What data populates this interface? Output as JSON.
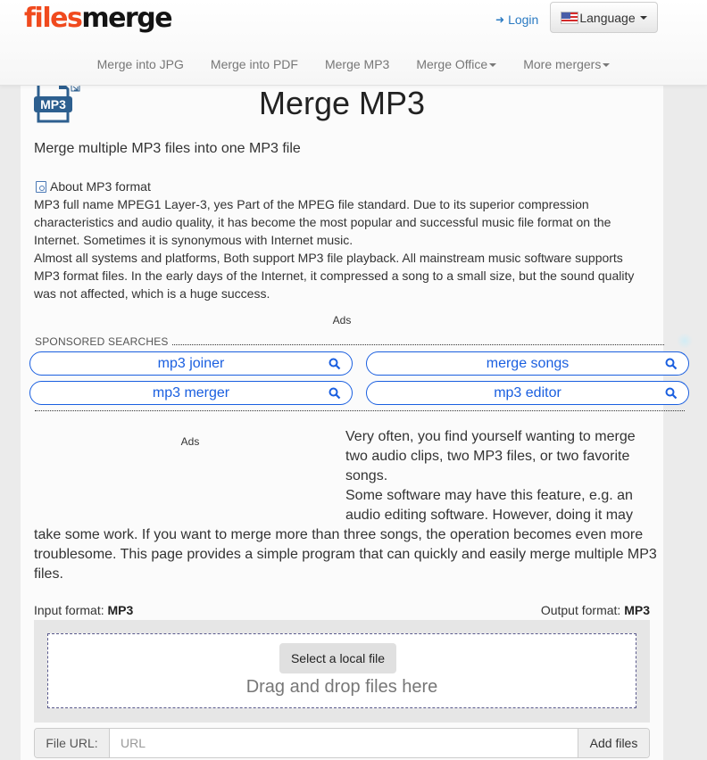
{
  "header": {
    "logo_part1": "files",
    "logo_part2": "merge",
    "login_label": "Login",
    "language_label": "Language",
    "nav": [
      {
        "label": "Merge into JPG",
        "dropdown": false
      },
      {
        "label": "Merge into PDF",
        "dropdown": false
      },
      {
        "label": "Merge MP3",
        "dropdown": false
      },
      {
        "label": "Merge Office",
        "dropdown": true
      },
      {
        "label": "More mergers",
        "dropdown": true
      }
    ]
  },
  "main": {
    "icon_label": "MP3",
    "title": "Merge MP3",
    "subtitle": "Merge multiple MP3 files into one MP3 file",
    "about_heading": "About MP3 format",
    "about_paragraphs": [
      "MP3 full name MPEG1 Layer-3, yes Part of the MPEG file standard. Due to its superior compression characteristics and audio quality, it has become the most popular and successful music file format on the Internet. Sometimes it is synonymous with Internet music.",
      "Almost all systems and platforms, Both support MP3 file playback. All mainstream music software supports MP3 format files. In the early days of the Internet, it compressed a song to a small size, but the sound quality was not affected, which is a huge success."
    ],
    "ads_label": "Ads",
    "sponsored_label": "SPONSORED SEARCHES",
    "sponsored_searches": [
      "mp3 joiner",
      "merge songs",
      "mp3 merger",
      "mp3 editor"
    ],
    "long_text_paragraphs": [
      "Very often, you find yourself wanting to merge two audio clips, two MP3 files, or two favorite songs.",
      "Some software may have this feature, e.g. an audio editing software. However, doing it may take some work. If you want to merge more than three songs, the operation becomes even more troublesome. This page provides a simple program that can quickly and easily merge multiple MP3 files."
    ]
  },
  "converter": {
    "input_format_label": "Input format:",
    "input_format_value": "MP3",
    "output_format_label": "Output format:",
    "output_format_value": "MP3",
    "select_button": "Select a local file",
    "drag_text": "Drag and drop files here",
    "url_label": "File URL:",
    "url_placeholder": "URL",
    "url_value": "",
    "add_files_button": "Add files"
  },
  "colors": {
    "logo_accent": "#f04a1e",
    "link_blue": "#2a7ac2",
    "sponsored_blue": "#1a5fe0",
    "icon_blue": "#2d5f8f"
  }
}
